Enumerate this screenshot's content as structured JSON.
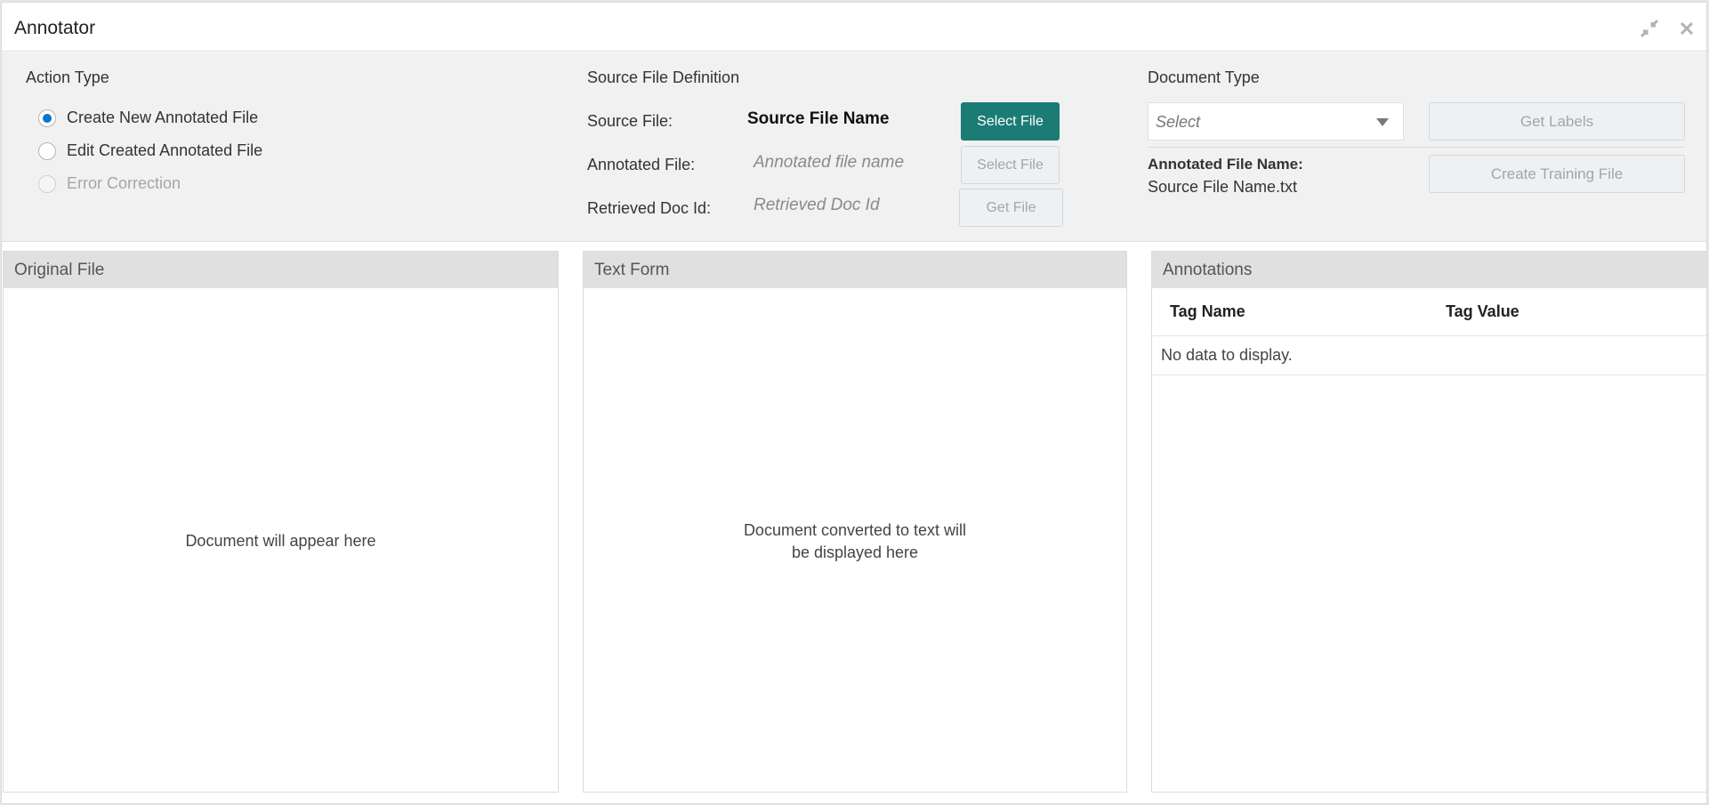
{
  "window": {
    "title": "Annotator",
    "icons": [
      "collapse-icon",
      "close-icon"
    ]
  },
  "action_type": {
    "title": "Action Type",
    "options": [
      {
        "label": "Create New Annotated File",
        "checked": true,
        "disabled": false
      },
      {
        "label": "Edit Created Annotated File",
        "checked": false,
        "disabled": false
      },
      {
        "label": "Error Correction",
        "checked": false,
        "disabled": true
      }
    ]
  },
  "source_file_definition": {
    "title": "Source File Definition",
    "source_file": {
      "label": "Source File:",
      "value": "Source File Name",
      "button": "Select File"
    },
    "annotated_file": {
      "label": "Annotated File:",
      "placeholder": "Annotated file name",
      "button": "Select File"
    },
    "retrieved_doc": {
      "label": "Retrieved Doc Id:",
      "placeholder": "Retrieved Doc Id",
      "button": "Get File"
    }
  },
  "document_type": {
    "title": "Document Type",
    "select_placeholder": "Select",
    "get_labels_button": "Get Labels",
    "annotated_file_name_label": "Annotated File Name:",
    "annotated_file_name_value": "Source File Name.txt",
    "create_training_button": "Create Training File"
  },
  "panels": {
    "original": {
      "title": "Original File",
      "placeholder": "Document will appear here"
    },
    "text_form": {
      "title": "Text Form",
      "placeholder_line1": "Document converted to text will",
      "placeholder_line2": "be displayed here"
    },
    "annotations": {
      "title": "Annotations",
      "columns": [
        "Tag Name",
        "Tag Value"
      ],
      "empty_message": "No data to display."
    }
  },
  "colors": {
    "primary_button": "#1b7c75",
    "radio_checked": "#0a74c9",
    "panel_header": "#e0e0e0",
    "top_area": "#f1f1f1"
  }
}
